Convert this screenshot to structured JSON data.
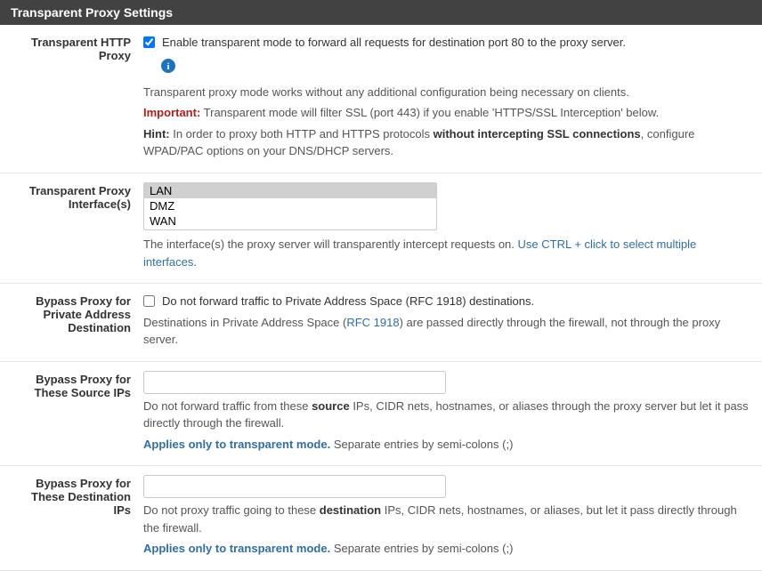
{
  "panel": {
    "title": "Transparent Proxy Settings"
  },
  "http_proxy": {
    "label": "Transparent HTTP Proxy",
    "checkbox_label": "Enable transparent mode to forward all requests for destination port 80 to the proxy server.",
    "checked": true,
    "desc1": "Transparent proxy mode works without any additional configuration being necessary on clients.",
    "important_label": "Important:",
    "important_text": " Transparent mode will filter SSL (port 443) if you enable 'HTTPS/SSL Interception' below.",
    "hint_label": "Hint:",
    "hint_pre": " In order to proxy both HTTP and HTTPS protocols ",
    "hint_bold": "without intercepting SSL connections",
    "hint_post": ", configure WPAD/PAC options on your DNS/DHCP servers."
  },
  "interfaces": {
    "label": "Transparent Proxy Interface(s)",
    "options": [
      "LAN",
      "DMZ",
      "WAN"
    ],
    "selected": "LAN",
    "help_pre": "The interface(s) the proxy server will transparently intercept requests on. ",
    "help_link": "Use CTRL + click to select multiple interfaces."
  },
  "bypass_private": {
    "label": "Bypass Proxy for Private Address Destination",
    "checkbox_label": "Do not forward traffic to Private Address Space (RFC 1918) destinations.",
    "checked": false,
    "help_pre": "Destinations in Private Address Space (",
    "help_link": "RFC 1918",
    "help_post": ") are passed directly through the firewall, not through the proxy server."
  },
  "bypass_source": {
    "label": "Bypass Proxy for These Source IPs",
    "value": "",
    "help_pre": "Do not forward traffic from these ",
    "help_bold": "source",
    "help_post": " IPs, CIDR nets, hostnames, or aliases through the proxy server but let it pass directly through the firewall.",
    "applies": "Applies only to transparent mode.",
    "applies_post": " Separate entries by semi-colons (;)"
  },
  "bypass_dest": {
    "label": "Bypass Proxy for These Destination IPs",
    "value": "",
    "help_pre": "Do not proxy traffic going to these ",
    "help_bold": "destination",
    "help_post": " IPs, CIDR nets, hostnames, or aliases, but let it pass directly through the firewall.",
    "applies": "Applies only to transparent mode.",
    "applies_post": " Separate entries by semi-colons (;)"
  }
}
